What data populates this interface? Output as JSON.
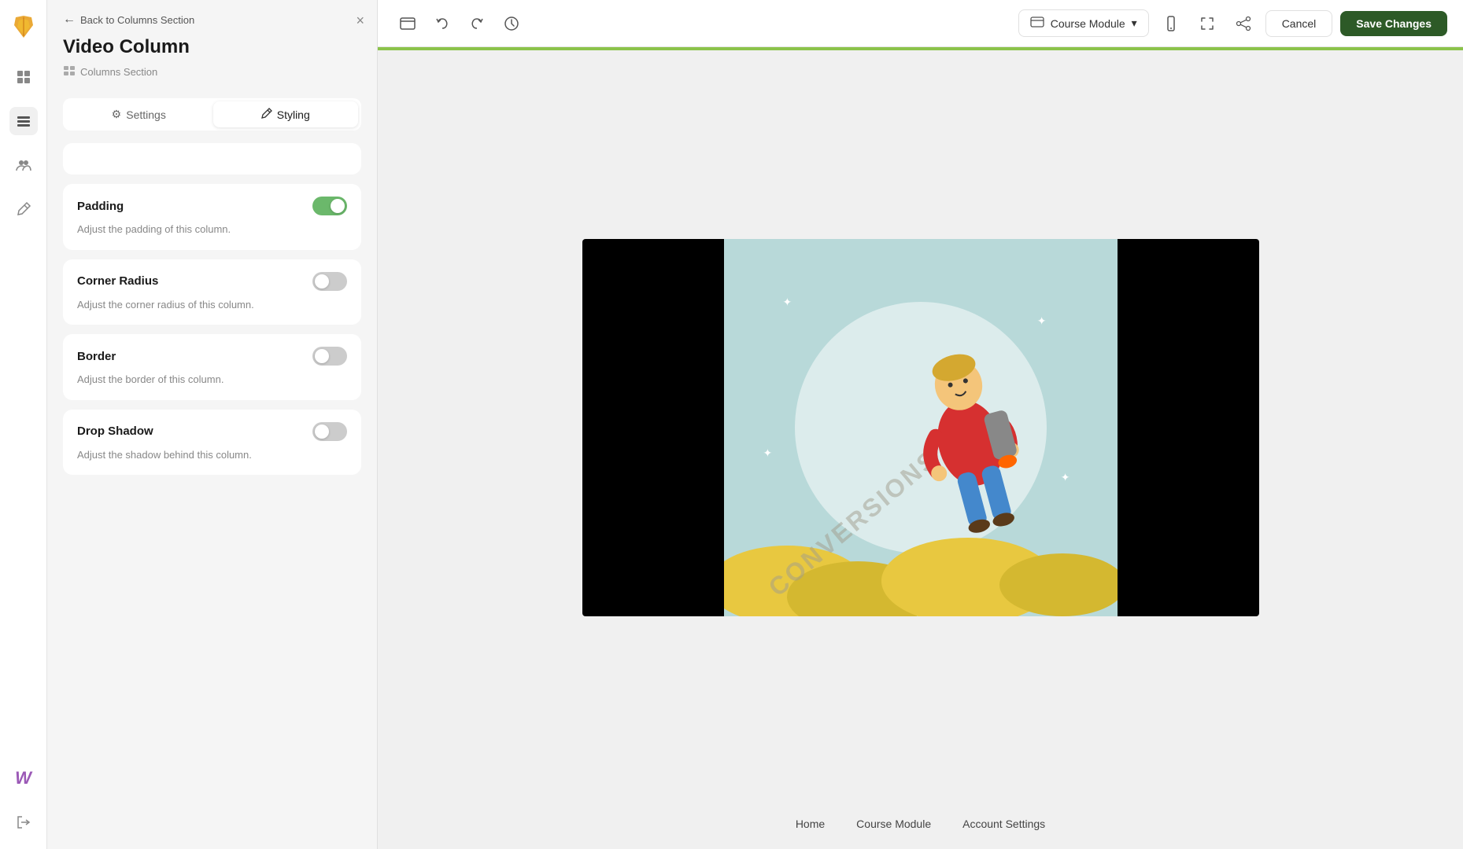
{
  "app": {
    "logo_icon": "✕"
  },
  "rail": {
    "icons": [
      {
        "name": "layout-icon",
        "symbol": "⊞",
        "active": false
      },
      {
        "name": "layers-icon",
        "symbol": "☰",
        "active": true
      },
      {
        "name": "people-icon",
        "symbol": "👥",
        "active": false
      },
      {
        "name": "brush-icon",
        "symbol": "🖌",
        "active": false
      },
      {
        "name": "w-brand-icon",
        "symbol": "W",
        "active": false
      },
      {
        "name": "logout-icon",
        "symbol": "⎋",
        "active": false
      }
    ]
  },
  "panel": {
    "back_label": "Back to Columns Section",
    "close_label": "×",
    "title": "Video Column",
    "section_label": "Columns Section",
    "tabs": [
      {
        "label": "Settings",
        "icon": "⚙",
        "active": false
      },
      {
        "label": "Styling",
        "icon": "✏",
        "active": true
      }
    ],
    "settings": [
      {
        "id": "padding",
        "title": "Padding",
        "description": "Adjust the padding of this column.",
        "toggle_on": false
      },
      {
        "id": "corner-radius",
        "title": "Corner Radius",
        "description": "Adjust the corner radius of this column.",
        "toggle_on": false
      },
      {
        "id": "border",
        "title": "Border",
        "description": "Adjust the border of this column.",
        "toggle_on": false
      },
      {
        "id": "drop-shadow",
        "title": "Drop Shadow",
        "description": "Adjust the shadow behind this column.",
        "toggle_on": false
      }
    ]
  },
  "toolbar": {
    "module_label": "Course Module",
    "cancel_label": "Cancel",
    "save_label": "Save Changes"
  },
  "footer_nav": {
    "links": [
      {
        "label": "Home"
      },
      {
        "label": "Course Module"
      },
      {
        "label": "Account Settings"
      }
    ]
  }
}
